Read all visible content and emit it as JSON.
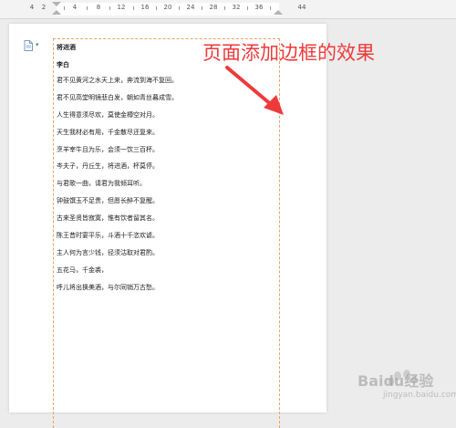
{
  "ruler": {
    "ticks": [
      "4",
      "2",
      "4",
      "8",
      "12",
      "16",
      "20",
      "24",
      "28",
      "32",
      "36",
      "44"
    ]
  },
  "document": {
    "title": "将进酒",
    "author": "李白",
    "lines": [
      "君不见黄河之水天上来，奔流到海不复回。",
      "君不见高堂明镜悲白发，朝如青丝暮成雪。",
      "人生得意须尽欢，莫使金樽空对月。",
      "天生我材必有用，千金散尽还复来。",
      "烹羊宰牛且为乐，会须一饮三百杯。",
      "岑夫子，丹丘生，将进酒，杯莫停。",
      "与君歌一曲，请君为我倾耳听。",
      "钟鼓馔玉不足贵，但愿长醉不复醒。",
      "古来圣贤皆寂寞，惟有饮者留其名。",
      "陈王昔时宴平乐，斗酒十千恣欢谑。",
      "主人何为言少钱，径须沽取对君酌。",
      "五花马，千金裘，",
      "呼儿将出换美酒，与尔同销万古愁。"
    ]
  },
  "annotation": {
    "text": "页面添加边框的效果",
    "color": "#ee3a3a"
  },
  "watermark": {
    "text": "Baidu经验",
    "sub": "jingyan.baidu.com"
  },
  "colors": {
    "border": "#f0a062",
    "background": "#ececec"
  }
}
